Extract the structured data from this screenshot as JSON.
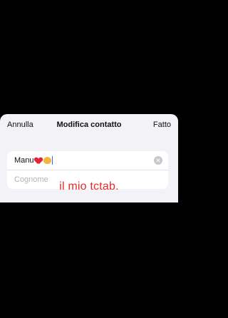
{
  "navbar": {
    "cancel_label": "Annulla",
    "title": "Modifica contatto",
    "done_label": "Fatto"
  },
  "form": {
    "first_name_value": "Manu",
    "first_name_emojis": [
      "heart-emoji",
      "cat-emoji"
    ],
    "last_name_placeholder": "Cognome",
    "clear_icon": "clear-circle-icon"
  },
  "caption": {
    "text": "il mio tctab."
  },
  "colors": {
    "caption": "#e52a2a",
    "sheet_background": "#f2f2f7",
    "background": "#000000"
  }
}
